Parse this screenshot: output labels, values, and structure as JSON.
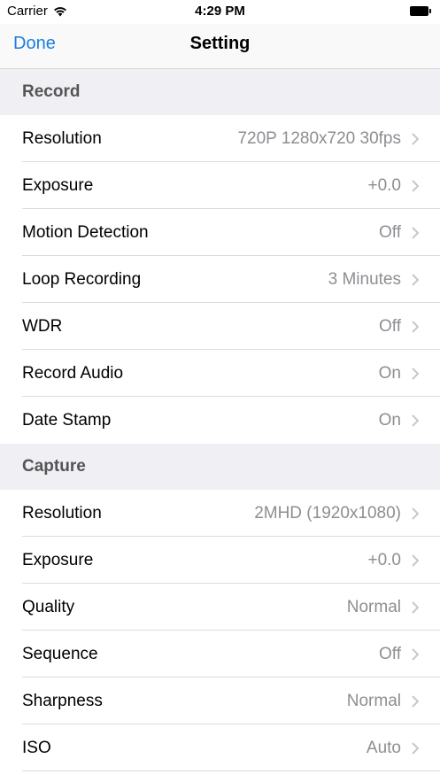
{
  "status_bar": {
    "carrier": "Carrier",
    "time": "4:29 PM"
  },
  "nav": {
    "done_label": "Done",
    "title": "Setting"
  },
  "sections": [
    {
      "header": "Record",
      "rows": [
        {
          "label": "Resolution",
          "value": "720P 1280x720 30fps"
        },
        {
          "label": "Exposure",
          "value": "+0.0"
        },
        {
          "label": "Motion Detection",
          "value": "Off"
        },
        {
          "label": "Loop Recording",
          "value": "3 Minutes"
        },
        {
          "label": "WDR",
          "value": "Off"
        },
        {
          "label": "Record Audio",
          "value": "On"
        },
        {
          "label": "Date Stamp",
          "value": "On"
        }
      ]
    },
    {
      "header": "Capture",
      "rows": [
        {
          "label": "Resolution",
          "value": "2MHD (1920x1080)"
        },
        {
          "label": "Exposure",
          "value": "+0.0"
        },
        {
          "label": "Quality",
          "value": "Normal"
        },
        {
          "label": "Sequence",
          "value": "Off"
        },
        {
          "label": "Sharpness",
          "value": "Normal"
        },
        {
          "label": "ISO",
          "value": "Auto"
        }
      ]
    }
  ],
  "colors": {
    "accent": "#1a7ee0",
    "section_bg": "#efeff4",
    "value_text": "#8e8e93"
  }
}
